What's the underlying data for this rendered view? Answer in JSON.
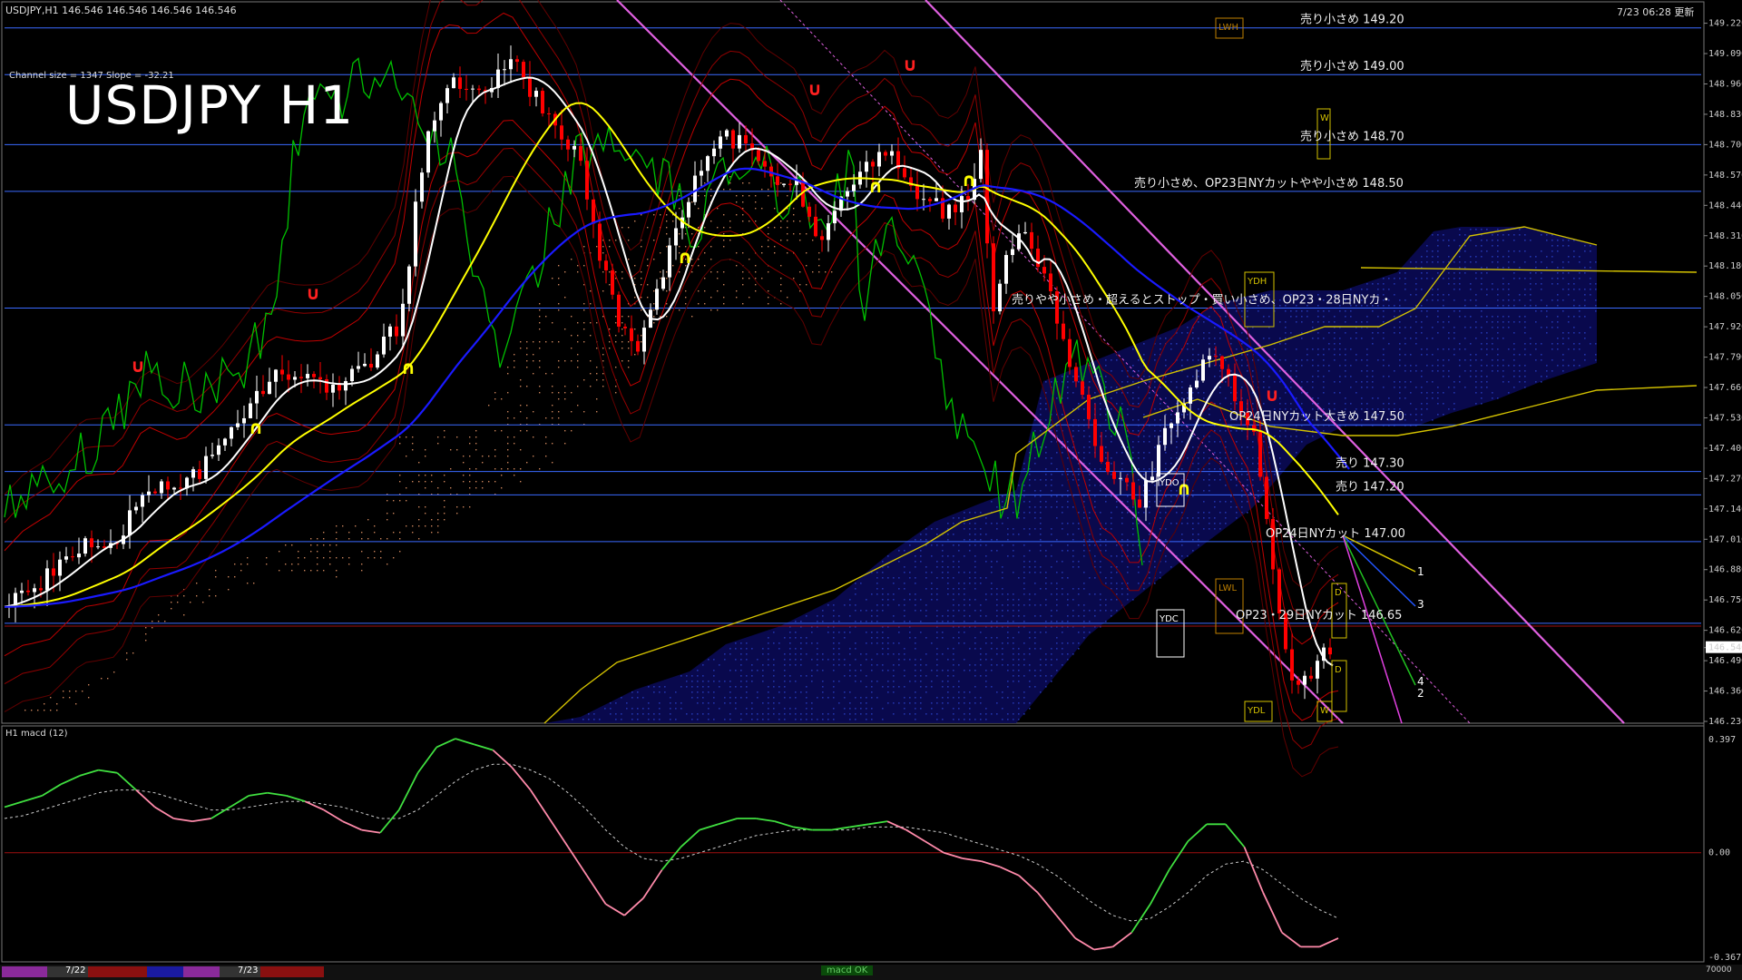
{
  "header": {
    "symbol_info": "USDJPY,H1  146.546 146.546 146.546 146.546",
    "update_time": "7/23 06:28 更新",
    "channel_info": "Channel size = 1347 Slope = -32.21",
    "title": "USDJPY H1"
  },
  "indicator": {
    "label": "H1  macd (12)",
    "levels": [
      "0.397",
      "0.00",
      "-0.367"
    ],
    "bottom_right": "70000",
    "status": "macd OK"
  },
  "colors": {
    "background": "#000000",
    "bull_candle": "#ffffff",
    "bear_candle": "#ff0000",
    "ma_white": "#ffffff",
    "ma_yellow": "#ffff00",
    "ma_blue": "#1a1aff",
    "chikou": "#00c000",
    "senkou_a": "#d4c200",
    "kumo_dots": "#2233aa",
    "kumo_dots_orange": "#c8825a",
    "channel": "#e060e0",
    "level_line": "#3a6aff",
    "macd_up": "#40e040",
    "macd_down": "#ff8aaa",
    "signal": "#cccccc"
  },
  "bottom_bar": {
    "dates": [
      "7/22",
      "7/23"
    ]
  },
  "chart_data": {
    "type": "candlestick",
    "title": "USDJPY H1",
    "timeframe": "H1",
    "x_labels": [
      "7/22",
      "7/23"
    ],
    "ylim": [
      146.23,
      149.3
    ],
    "y_ticks": [
      "149.220",
      "149.090",
      "148.960",
      "148.830",
      "148.700",
      "148.570",
      "148.440",
      "148.310",
      "148.180",
      "148.050",
      "147.920",
      "147.790",
      "147.660",
      "147.530",
      "147.400",
      "147.270",
      "147.140",
      "147.010",
      "146.880",
      "146.750",
      "146.620",
      "146.546",
      "146.490",
      "146.360",
      "146.230"
    ],
    "current_price": "146.546",
    "levels": [
      {
        "price": 149.2,
        "label": "売り小さめ 149.20"
      },
      {
        "price": 149.0,
        "label": "売り小さめ 149.00"
      },
      {
        "price": 148.7,
        "label": "売り小さめ 148.70"
      },
      {
        "price": 148.5,
        "label": "売り小さめ、OP23日NYカットやや小さめ 148.50"
      },
      {
        "price": 148.0,
        "label": "売りやや小さめ・超えるとストップ・買い小さめ、OP23・28日NYカ・"
      },
      {
        "price": 147.5,
        "label": "OP24日NYカット大きめ 147.50"
      },
      {
        "price": 147.3,
        "label": "売り 147.30"
      },
      {
        "price": 147.2,
        "label": "売り 147.20"
      },
      {
        "price": 147.0,
        "label": "OP24日NYカット 147.00"
      },
      {
        "price": 146.65,
        "label": "OP23・29日NYカット 146.65"
      }
    ],
    "boxes": [
      "LWH",
      "W",
      "YDH",
      "YDO",
      "LWL",
      "YDC",
      "YDL",
      "D",
      "D",
      "W"
    ],
    "projection_labels": [
      "1",
      "3",
      "4",
      "2"
    ],
    "macd": {
      "name": "macd (12)",
      "levels": [
        0.397,
        0.0,
        -0.367
      ],
      "values": [
        0.16,
        0.18,
        0.2,
        0.24,
        0.27,
        0.29,
        0.28,
        0.22,
        0.16,
        0.12,
        0.11,
        0.12,
        0.16,
        0.2,
        0.21,
        0.2,
        0.18,
        0.15,
        0.11,
        0.08,
        0.07,
        0.15,
        0.28,
        0.37,
        0.4,
        0.38,
        0.36,
        0.3,
        0.22,
        0.12,
        0.02,
        -0.08,
        -0.18,
        -0.22,
        -0.16,
        -0.06,
        0.02,
        0.08,
        0.1,
        0.12,
        0.12,
        0.11,
        0.09,
        0.08,
        0.08,
        0.09,
        0.1,
        0.11,
        0.08,
        0.04,
        0.0,
        -0.02,
        -0.03,
        -0.05,
        -0.08,
        -0.14,
        -0.22,
        -0.3,
        -0.34,
        -0.33,
        -0.28,
        -0.18,
        -0.06,
        0.04,
        0.1,
        0.1,
        0.02,
        -0.14,
        -0.28,
        -0.33,
        -0.33,
        -0.3
      ],
      "signal": [
        0.12,
        0.13,
        0.15,
        0.17,
        0.19,
        0.21,
        0.22,
        0.22,
        0.21,
        0.19,
        0.17,
        0.15,
        0.15,
        0.16,
        0.17,
        0.18,
        0.18,
        0.17,
        0.16,
        0.14,
        0.12,
        0.12,
        0.15,
        0.2,
        0.25,
        0.29,
        0.31,
        0.31,
        0.29,
        0.26,
        0.21,
        0.15,
        0.08,
        0.02,
        -0.02,
        -0.03,
        -0.02,
        0.0,
        0.02,
        0.04,
        0.06,
        0.07,
        0.08,
        0.08,
        0.08,
        0.08,
        0.09,
        0.09,
        0.09,
        0.08,
        0.07,
        0.05,
        0.03,
        0.01,
        -0.01,
        -0.04,
        -0.08,
        -0.13,
        -0.18,
        -0.22,
        -0.24,
        -0.23,
        -0.19,
        -0.14,
        -0.08,
        -0.04,
        -0.03,
        -0.06,
        -0.11,
        -0.16,
        -0.2,
        -0.23
      ]
    }
  }
}
